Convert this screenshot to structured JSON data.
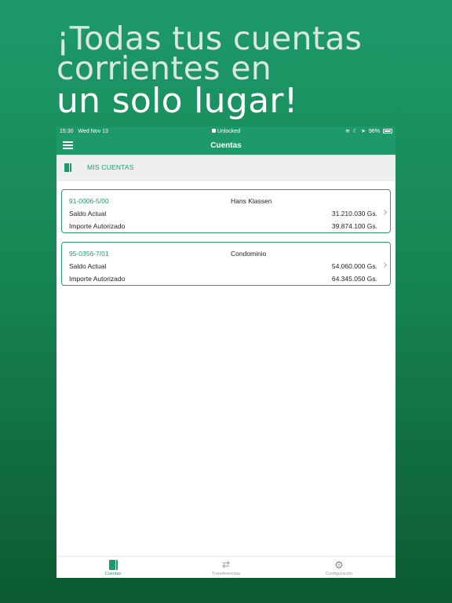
{
  "headline": {
    "line1": "¡Todas tus cuentas",
    "line2": "corrientes en",
    "line3": "un solo lugar!"
  },
  "status_bar": {
    "time": "15:30",
    "date": "Wed Nov 13",
    "lock_label": "Unlocked",
    "battery": "96%"
  },
  "nav": {
    "title": "Cuentas"
  },
  "section": {
    "label": "MIS CUENTAS"
  },
  "accounts": [
    {
      "number": "91-0006-5/00",
      "owner": "Hans Klassen",
      "saldo_label": "Saldo Actual",
      "saldo_value": "31.210.030 Gs.",
      "importe_label": "Importe Autorizado",
      "importe_value": "39.874.100 Gs."
    },
    {
      "number": "95-0356-7/01",
      "owner": "Condominio",
      "saldo_label": "Saldo Actual",
      "saldo_value": "54.060.000 Gs.",
      "importe_label": "Importe Autorizado",
      "importe_value": "64.345.050 Gs."
    }
  ],
  "tabs": [
    {
      "label": "Cuentas",
      "icon": "book-icon",
      "active": true
    },
    {
      "label": "Transferencias",
      "icon": "transfer-arrows-icon",
      "active": false
    },
    {
      "label": "Configuración",
      "icon": "gear-icon",
      "active": false
    }
  ],
  "colors": {
    "accent": "#1e9a6a"
  }
}
